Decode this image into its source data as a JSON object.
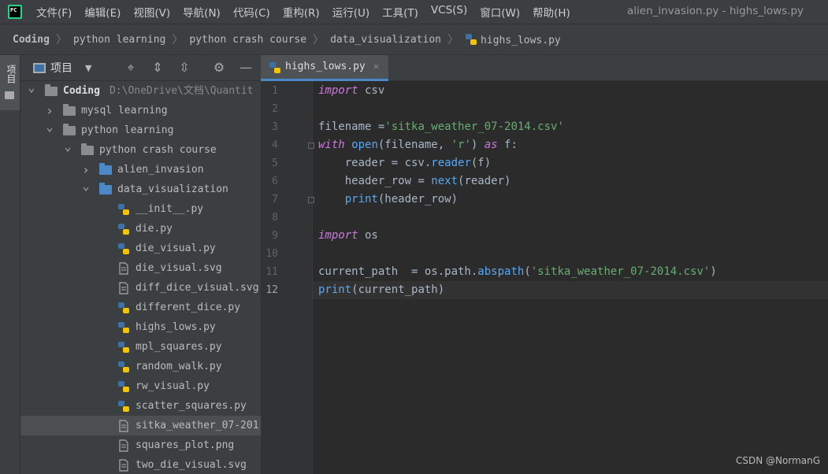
{
  "menubar": {
    "logo_text": "PC",
    "items": [
      "文件(F)",
      "编辑(E)",
      "视图(V)",
      "导航(N)",
      "代码(C)",
      "重构(R)",
      "运行(U)",
      "工具(T)",
      "VCS(S)",
      "窗口(W)",
      "帮助(H)"
    ],
    "window_title": "alien_invasion.py - highs_lows.py"
  },
  "breadcrumb": [
    "Coding",
    "python learning",
    "python crash course",
    "data_visualization",
    "highs_lows.py"
  ],
  "left_strip": {
    "tab_label": "项目"
  },
  "project_panel": {
    "title": "项目",
    "header_icons": [
      "locate-icon",
      "expand-all-icon",
      "collapse-all-icon",
      "gear-icon",
      "hide-icon"
    ],
    "tree": [
      {
        "label": "Coding",
        "path": "D:\\OneDrive\\文档\\Quantit",
        "type": "folder",
        "expanded": true,
        "bold": true
      },
      {
        "label": "mysql learning",
        "type": "folder",
        "expanded": false
      },
      {
        "label": "python learning",
        "type": "folder",
        "expanded": true
      },
      {
        "label": "python crash course",
        "type": "folder",
        "expanded": true
      },
      {
        "label": "alien_invasion",
        "type": "folder-blue",
        "expanded": false
      },
      {
        "label": "data_visualization",
        "type": "folder-blue",
        "expanded": true
      },
      {
        "label": "__init__.py",
        "type": "python"
      },
      {
        "label": "die.py",
        "type": "python"
      },
      {
        "label": "die_visual.py",
        "type": "python"
      },
      {
        "label": "die_visual.svg",
        "type": "file"
      },
      {
        "label": "diff_dice_visual.svg",
        "type": "file"
      },
      {
        "label": "different_dice.py",
        "type": "python"
      },
      {
        "label": "highs_lows.py",
        "type": "python"
      },
      {
        "label": "mpl_squares.py",
        "type": "python"
      },
      {
        "label": "random_walk.py",
        "type": "python"
      },
      {
        "label": "rw_visual.py",
        "type": "python"
      },
      {
        "label": "scatter_squares.py",
        "type": "python"
      },
      {
        "label": "sitka_weather_07-201",
        "type": "file",
        "selected": true
      },
      {
        "label": "squares_plot.png",
        "type": "file"
      },
      {
        "label": "two_die_visual.svg",
        "type": "file"
      }
    ]
  },
  "editor": {
    "tab_label": "highs_lows.py",
    "current_line": 12,
    "lines": [
      [
        {
          "t": "import",
          "c": "kw"
        },
        {
          "t": " csv"
        }
      ],
      [],
      [
        {
          "t": "filename ="
        },
        {
          "t": "'sitka_weather_07-2014.csv'",
          "c": "str"
        }
      ],
      [
        {
          "t": "with",
          "c": "kw"
        },
        {
          "t": " "
        },
        {
          "t": "open",
          "c": "fn"
        },
        {
          "t": "(filename, "
        },
        {
          "t": "'r'",
          "c": "str"
        },
        {
          "t": ") "
        },
        {
          "t": "as",
          "c": "kw"
        },
        {
          "t": " f:"
        }
      ],
      [
        {
          "t": "    reader = csv."
        },
        {
          "t": "reader",
          "c": "fn"
        },
        {
          "t": "(f)"
        }
      ],
      [
        {
          "t": "    header_row = "
        },
        {
          "t": "next",
          "c": "fn"
        },
        {
          "t": "(reader)"
        }
      ],
      [
        {
          "t": "    "
        },
        {
          "t": "print",
          "c": "fn"
        },
        {
          "t": "(header_row)"
        }
      ],
      [],
      [
        {
          "t": "import",
          "c": "kw"
        },
        {
          "t": " os"
        }
      ],
      [],
      [
        {
          "t": "current_path  = os.path."
        },
        {
          "t": "abspath",
          "c": "fn"
        },
        {
          "t": "("
        },
        {
          "t": "'sitka_weather_07-2014.csv'",
          "c": "str"
        },
        {
          "t": ")"
        }
      ],
      [
        {
          "t": "print",
          "c": "fn"
        },
        {
          "t": "(current_path)"
        }
      ]
    ]
  },
  "watermark": "CSDN @NormanG"
}
